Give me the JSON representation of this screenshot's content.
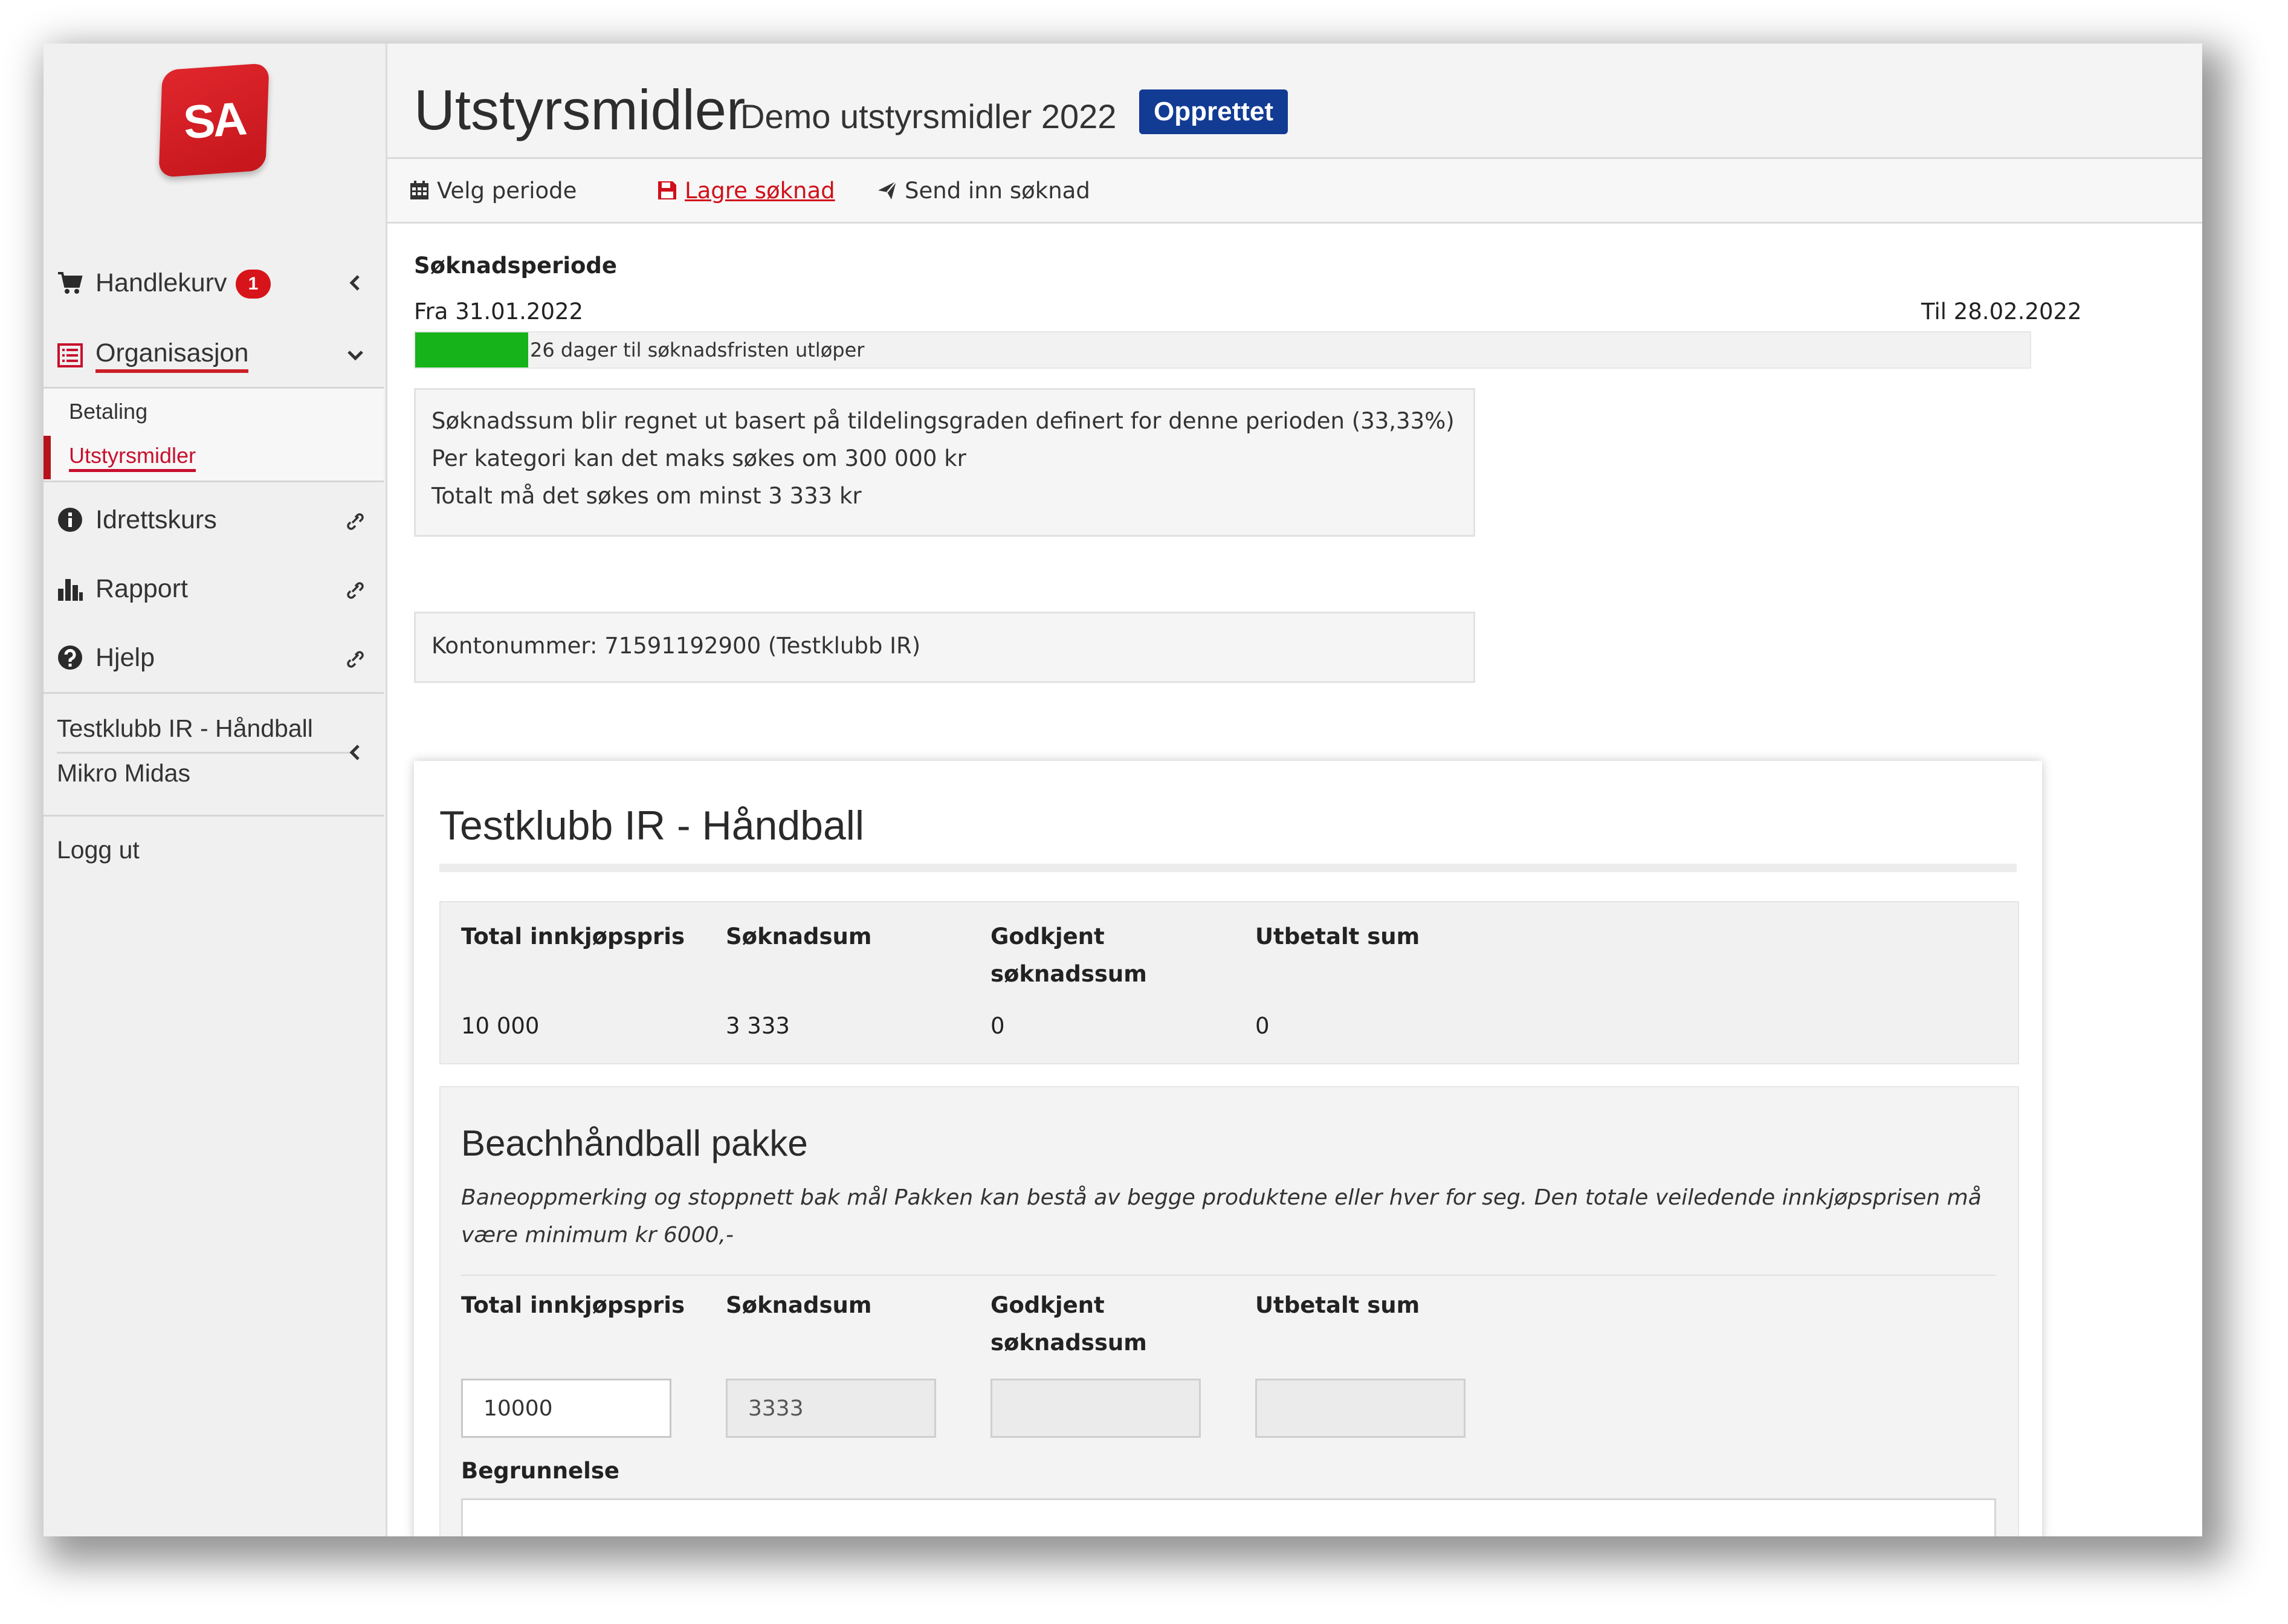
{
  "colors": {
    "brand_red": "#d7141a",
    "status_blue": "#123b93",
    "progress_green": "#17b31a",
    "link_red": "#c8102e"
  },
  "logo": {
    "text": "SA"
  },
  "sidebar": {
    "cart": {
      "label": "Handlekurv",
      "badge": "1",
      "icon": "cart-icon"
    },
    "organisation": {
      "label": "Organisasjon",
      "icon": "list-icon",
      "children": [
        {
          "label": "Betaling"
        },
        {
          "label": "Utstyrsmidler",
          "active": true
        }
      ]
    },
    "links": [
      {
        "label": "Idrettskurs",
        "icon": "info-circle-icon"
      },
      {
        "label": "Rapport",
        "icon": "bar-chart-icon"
      },
      {
        "label": "Hjelp",
        "icon": "question-circle-icon"
      }
    ],
    "user": {
      "org": "Testklubb IR - Håndball",
      "name": "Mikro Midas"
    },
    "logout": "Logg ut"
  },
  "header": {
    "title": "Utstyrsmidler",
    "subtitle": "Demo utstyrsmidler 2022",
    "status": "Opprettet"
  },
  "toolbar": {
    "period": "Velg periode",
    "save": "Lagre søknad",
    "submit": "Send inn søknad"
  },
  "period": {
    "heading": "Søknadsperiode",
    "from": "Fra 31.01.2022",
    "to": "Til 28.02.2022",
    "progress_fraction": 0.07,
    "progress_label": "26 dager til søknadsfristen utløper"
  },
  "info": {
    "lines": [
      "Søknadssum blir regnet ut basert på tildelingsgraden definert for denne perioden (33,33%)",
      "Per kategori kan det maks søkes om 300 000 kr",
      "Totalt må det søkes om minst 3 333 kr"
    ],
    "account": "Kontonummer: 71591192900 (Testklubb IR)"
  },
  "club": {
    "title": "Testklubb IR - Håndball",
    "columns": [
      "Total innkjøpspris",
      "Søknadsum",
      "Godkjent søknadssum",
      "Utbetalt sum"
    ],
    "summary": {
      "total": "10 000",
      "applied": "3 333",
      "approved": "0",
      "paid": "0"
    }
  },
  "package": {
    "title": "Beachhåndball pakke",
    "description": "Baneoppmerking og stoppnett bak mål Pakken kan bestå av begge produktene eller hver for seg. Den totale veiledende innkjøpsprisen må være minimum kr 6000,-",
    "columns": [
      "Total innkjøpspris",
      "Søknadsum",
      "Godkjent søknadssum",
      "Utbetalt sum"
    ],
    "fields": {
      "total": "10000",
      "applied": "3333",
      "approved": "",
      "paid": ""
    },
    "reason_label": "Begrunnelse"
  }
}
